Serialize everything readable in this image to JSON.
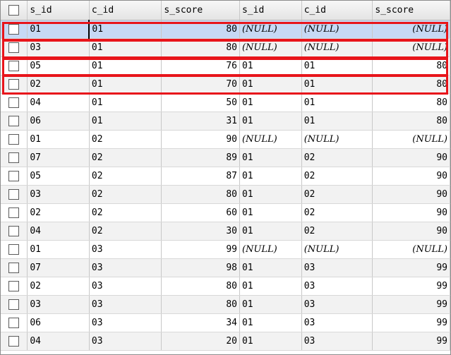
{
  "columns": [
    "s_id",
    "c_id",
    "s_score",
    "s_id",
    "c_id",
    "s_score"
  ],
  "rows": [
    [
      "01",
      "01",
      "80",
      "(NULL)",
      "(NULL)",
      "(NULL)"
    ],
    [
      "03",
      "01",
      "80",
      "(NULL)",
      "(NULL)",
      "(NULL)"
    ],
    [
      "05",
      "01",
      "76",
      "01",
      "01",
      "80"
    ],
    [
      "02",
      "01",
      "70",
      "01",
      "01",
      "80"
    ],
    [
      "04",
      "01",
      "50",
      "01",
      "01",
      "80"
    ],
    [
      "06",
      "01",
      "31",
      "01",
      "01",
      "80"
    ],
    [
      "01",
      "02",
      "90",
      "(NULL)",
      "(NULL)",
      "(NULL)"
    ],
    [
      "07",
      "02",
      "89",
      "01",
      "02",
      "90"
    ],
    [
      "05",
      "02",
      "87",
      "01",
      "02",
      "90"
    ],
    [
      "03",
      "02",
      "80",
      "01",
      "02",
      "90"
    ],
    [
      "02",
      "02",
      "60",
      "01",
      "02",
      "90"
    ],
    [
      "04",
      "02",
      "30",
      "01",
      "02",
      "90"
    ],
    [
      "01",
      "03",
      "99",
      "(NULL)",
      "(NULL)",
      "(NULL)"
    ],
    [
      "07",
      "03",
      "98",
      "01",
      "03",
      "99"
    ],
    [
      "02",
      "03",
      "80",
      "01",
      "03",
      "99"
    ],
    [
      "03",
      "03",
      "80",
      "01",
      "03",
      "99"
    ],
    [
      "06",
      "03",
      "34",
      "01",
      "03",
      "99"
    ],
    [
      "04",
      "03",
      "20",
      "01",
      "03",
      "99"
    ]
  ],
  "selected_row": 0,
  "highlight_color": "#e8151b",
  "checkbox_icon": "checkbox-unchecked-icon"
}
